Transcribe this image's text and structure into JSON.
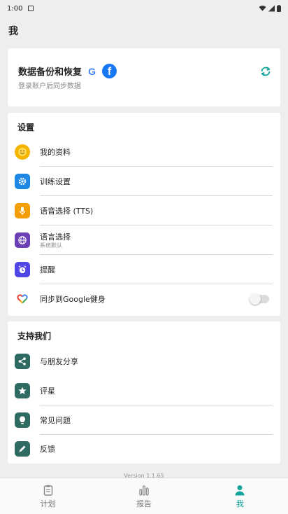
{
  "status_bar": {
    "time": "1:00"
  },
  "page": {
    "title": "我"
  },
  "backup": {
    "title": "数据备份和恢复",
    "subtitle": "登录账户后同步数据",
    "google_letter": "G",
    "facebook_letter": "f"
  },
  "settings": {
    "title": "设置",
    "items": [
      {
        "label": "我的资料",
        "icon": "smiley-icon",
        "color": "#f5b400"
      },
      {
        "label": "训练设置",
        "icon": "gear-icon",
        "color": "#1e88e5"
      },
      {
        "label": "语音选择 (TTS)",
        "icon": "microphone-icon",
        "color": "#f59e0b"
      },
      {
        "label": "语言选择",
        "sublabel": "系统默认",
        "icon": "globe-icon",
        "color": "#6a3fb5"
      },
      {
        "label": "提醒",
        "icon": "alarm-clock-icon",
        "color": "#4f46e5"
      },
      {
        "label": "同步到Google健身",
        "icon": "google-fit-icon",
        "toggle_on": false
      }
    ]
  },
  "support": {
    "title": "支持我们",
    "items": [
      {
        "label": "与朋友分享",
        "icon": "share-icon",
        "color": "#2f6b63"
      },
      {
        "label": "评星",
        "icon": "star-icon",
        "color": "#2f6b63"
      },
      {
        "label": "常见问题",
        "icon": "lightbulb-icon",
        "color": "#2f6b63"
      },
      {
        "label": "反馈",
        "icon": "pencil-icon",
        "color": "#2f6b63"
      }
    ]
  },
  "version": "Version 1.1.65",
  "nav": {
    "items": [
      {
        "label": "计划",
        "icon": "clipboard-icon",
        "active": false
      },
      {
        "label": "报告",
        "icon": "bar-chart-icon",
        "active": false
      },
      {
        "label": "我",
        "icon": "person-icon",
        "active": true
      }
    ]
  },
  "colors": {
    "accent": "#14a39a",
    "background": "#eeeeee",
    "card": "#ffffff"
  }
}
